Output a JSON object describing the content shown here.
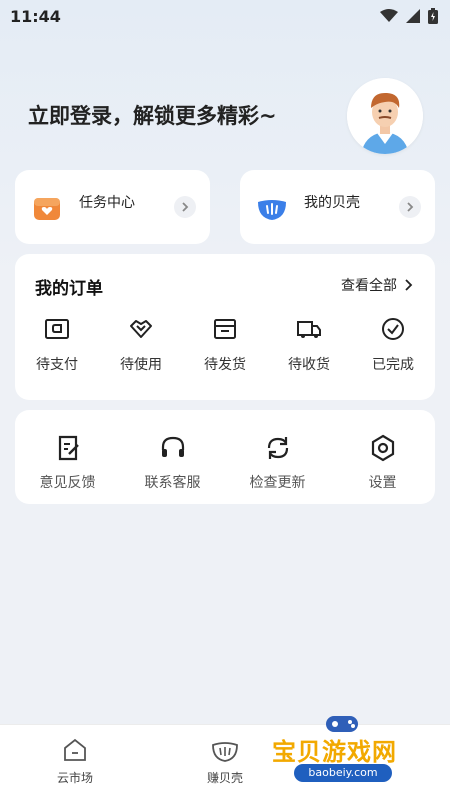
{
  "status_bar": {
    "time": "11:44"
  },
  "header": {
    "login_prompt": "立即登录，解锁更多精彩~"
  },
  "quick_cards": [
    {
      "label": "任务中心",
      "icon": "gift-box-icon"
    },
    {
      "label": "我的贝壳",
      "icon": "shell-icon"
    }
  ],
  "orders": {
    "title": "我的订单",
    "view_all": "查看全部",
    "items": [
      {
        "label": "待支付",
        "icon": "wallet-icon"
      },
      {
        "label": "待使用",
        "icon": "handshake-icon"
      },
      {
        "label": "待发货",
        "icon": "package-icon"
      },
      {
        "label": "待收货",
        "icon": "truck-icon"
      },
      {
        "label": "已完成",
        "icon": "check-circle-icon"
      }
    ]
  },
  "tools": {
    "items": [
      {
        "label": "意见反馈",
        "icon": "feedback-icon"
      },
      {
        "label": "联系客服",
        "icon": "headset-icon"
      },
      {
        "label": "检查更新",
        "icon": "refresh-icon"
      },
      {
        "label": "设置",
        "icon": "settings-hex-icon"
      }
    ]
  },
  "bottom_nav": [
    {
      "label": "云市场",
      "icon": "home-icon"
    },
    {
      "label": "赚贝壳",
      "icon": "shell-outline-icon"
    }
  ],
  "watermark": {
    "title": "宝贝游戏网",
    "url": "baobeiy.com"
  },
  "colors": {
    "accent_orange": "#f0883a",
    "accent_blue": "#3b7fe8",
    "background": "#eef1f6",
    "watermark_yellow": "#f2a900"
  }
}
